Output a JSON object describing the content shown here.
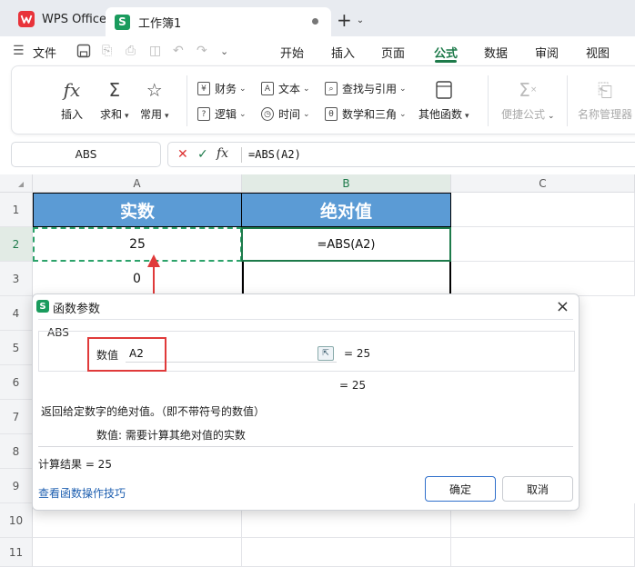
{
  "titlebar": {
    "app_tab": "WPS Office",
    "doc_tab": "工作簿1",
    "doc_badge": "S",
    "new_tab": "+"
  },
  "menu": {
    "file": "文件",
    "tabs": [
      "开始",
      "插入",
      "页面",
      "公式",
      "数据",
      "审阅",
      "视图"
    ],
    "active_tab": "公式",
    "accent_color": "#1d7a4a"
  },
  "ribbon": {
    "insert": "插入",
    "sum": "求和",
    "common": "常用",
    "finance": "财务",
    "logic": "逻辑",
    "text": "文本",
    "time": "时间",
    "lookup": "查找与引用",
    "math": "数学和三角",
    "other": "其他函数",
    "quick_formula": "便捷公式",
    "name_manager": "名称管理器"
  },
  "formula_bar": {
    "name_box": "ABS",
    "fx": "fx",
    "formula": "=ABS(A2)"
  },
  "sheet": {
    "columns": [
      "A",
      "B",
      "C"
    ],
    "rows": [
      "1",
      "2",
      "3",
      "4",
      "5",
      "6",
      "7",
      "8",
      "9",
      "10",
      "11"
    ],
    "A1": "实数",
    "B1": "绝对值",
    "A2": "25",
    "B2": "=ABS(A2)",
    "A3": "0",
    "header_color": "#5b9bd5"
  },
  "dialog": {
    "title": "函数参数",
    "badge": "S",
    "close": "×",
    "function_name": "ABS",
    "arg_label": "数值",
    "arg_value": "A2",
    "arg_result": "=  25",
    "function_result": "=  25",
    "description": "返回给定数字的绝对值。（即不带符号的数值）",
    "arg_description": "数值:  需要计算其绝对值的实数",
    "calc_result": "计算结果  =  25",
    "help_link": "查看函数操作技巧",
    "ok": "确定",
    "cancel": "取消"
  }
}
